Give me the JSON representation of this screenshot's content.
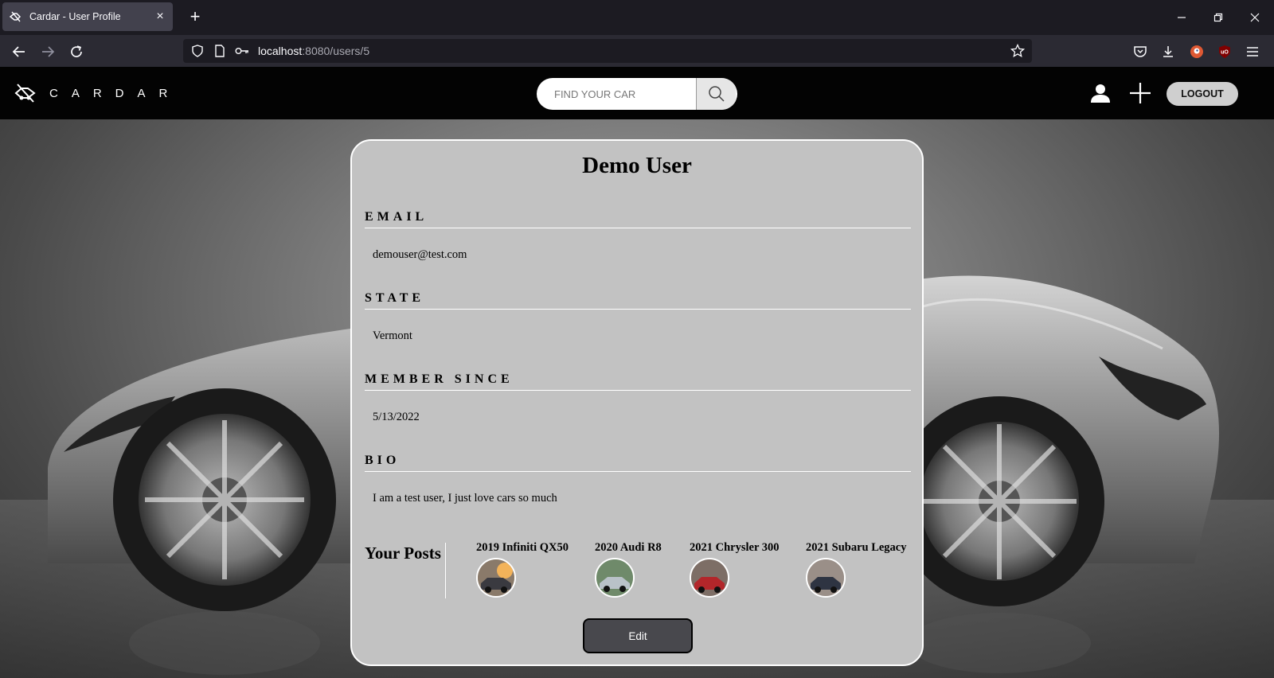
{
  "browser": {
    "tab_title": "Cardar - User Profile",
    "url_host": "localhost",
    "url_path": ":8080/users/5"
  },
  "header": {
    "logo_text": "CARDAR",
    "search_placeholder": "FIND YOUR CAR",
    "logout_label": "LOGOUT"
  },
  "profile": {
    "name": "Demo User",
    "email_label": "EMAIL",
    "email": "demouser@test.com",
    "state_label": "STATE",
    "state": "Vermont",
    "member_since_label": "MEMBER SINCE",
    "member_since": "5/13/2022",
    "bio_label": "BIO",
    "bio": "I am a test user, I just love cars so much",
    "posts_title": "Your Posts",
    "posts": [
      {
        "name": "2019 Infiniti QX50"
      },
      {
        "name": "2020 Audi R8"
      },
      {
        "name": "2021 Chrysler 300"
      },
      {
        "name": "2021 Subaru Legacy"
      }
    ],
    "edit_label": "Edit"
  }
}
